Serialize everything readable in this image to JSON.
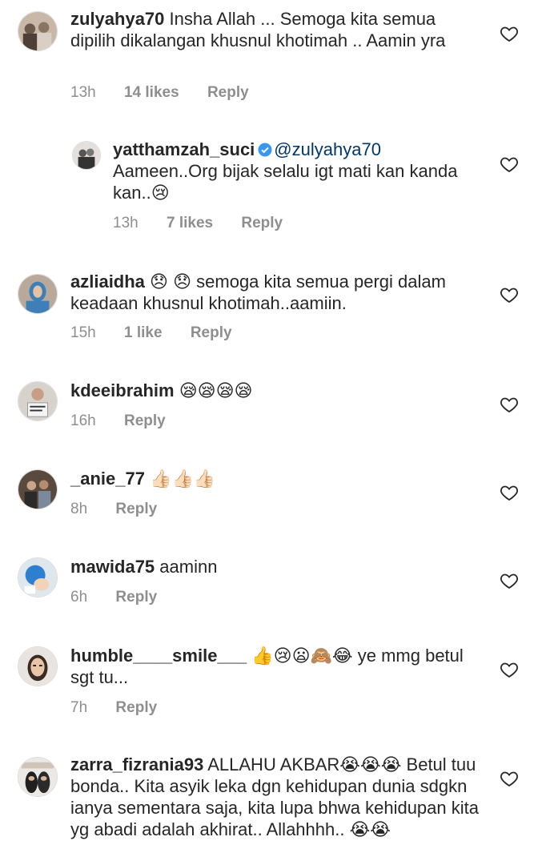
{
  "comments": [
    {
      "username": "zulyahya70",
      "text": "Insha Allah ... Semoga kita semua dipilih dikalangan khusnul khotimah .. Aamin yra",
      "time": "13h",
      "likes": "14 likes",
      "reply": "Reply"
    },
    {
      "username": "yatthamzah_suci",
      "mention": "@zulyahya70",
      "text": "Aameen..Org bijak selalu igt mati kan kanda kan..😢",
      "time": "13h",
      "likes": "7 likes",
      "reply": "Reply"
    },
    {
      "username": "azliaidha",
      "text": "😞 😞 semoga kita semua pergi dalam keadaan khusnul khotimah..aamiin.",
      "time": "15h",
      "likes": "1 like",
      "reply": "Reply"
    },
    {
      "username": "kdeeibrahim",
      "text": "😪😪😪😪",
      "time": "16h",
      "reply": "Reply"
    },
    {
      "username": "_anie_77",
      "text": "👍🏻👍🏻👍🏻",
      "time": "8h",
      "reply": "Reply"
    },
    {
      "username": "mawida75",
      "text": "aaminn",
      "time": "6h",
      "reply": "Reply"
    },
    {
      "username": "humble____smile___",
      "text": "👍😢😦🙈😂 ye mmg betul sgt tu...",
      "time": "7h",
      "reply": "Reply"
    },
    {
      "username": "zarra_fizrania93",
      "text": "ALLAHU AKBAR😭😭😭 Betul tuu bonda.. Kita asyik leka dgn kehidupan dunia sdgkn ianya sementara saja, kita lupa bhwa kehidupan kita yg abadi adalah akhirat.. Allahhhh.. 😭😭"
    }
  ],
  "icons": {
    "like": "heart-outline-icon",
    "verified": "verified-badge-icon"
  },
  "colors": {
    "text": "#262626",
    "meta": "#8e8e8e",
    "mention": "#00376b",
    "verified": "#3897f0"
  }
}
